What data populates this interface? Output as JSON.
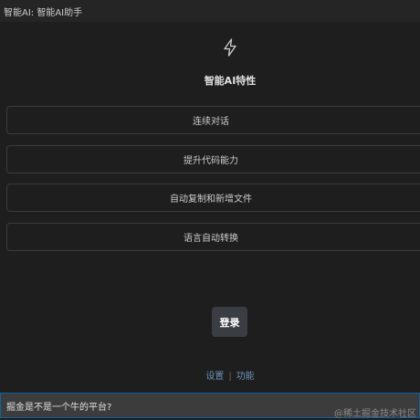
{
  "window": {
    "title": "智能AI: 智能AI助手"
  },
  "features": {
    "icon": "lightning-bolt-icon",
    "title": "智能AI特性",
    "items": [
      {
        "label": "连续对话"
      },
      {
        "label": "提升代码能力"
      },
      {
        "label": "自动复制和新增文件"
      },
      {
        "label": "语言自动转换"
      }
    ]
  },
  "login": {
    "label": "登录"
  },
  "links": {
    "settings": "设置",
    "separator": "|",
    "functions": "功能"
  },
  "input": {
    "value": "掘金是不是一个牛的平台?"
  },
  "watermark": {
    "text": "@稀土掘金技术社区"
  },
  "colors": {
    "background": "#1e1e1e",
    "button": "#3a3d41",
    "input_border": "#0e639c",
    "link": "#6f93b8"
  }
}
